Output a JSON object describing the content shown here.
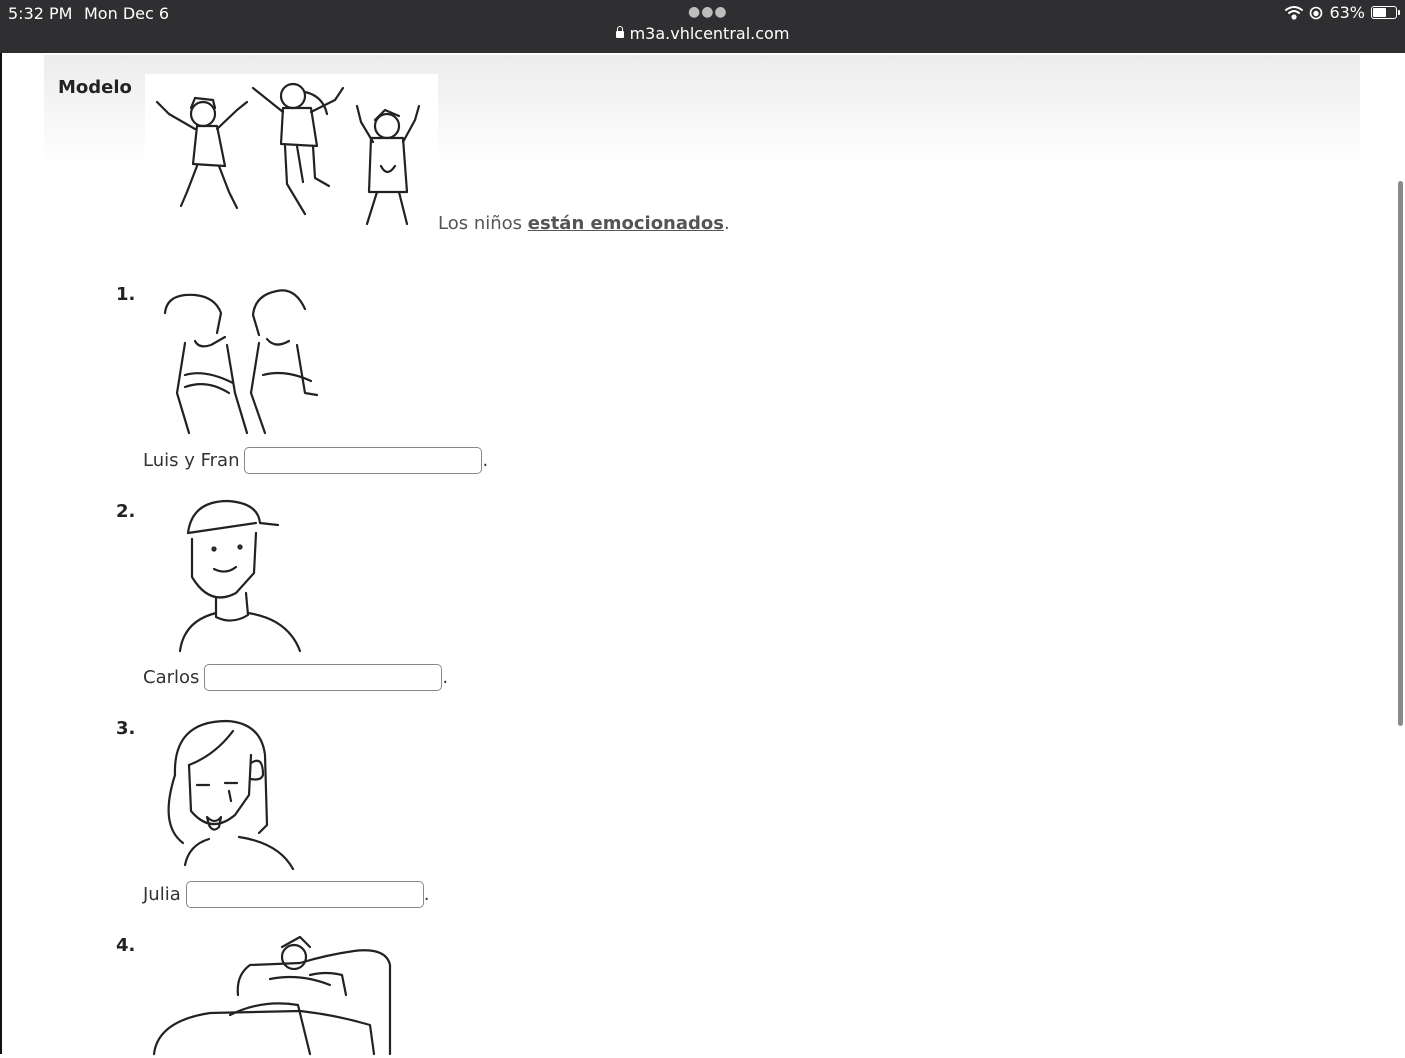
{
  "status_bar": {
    "time": "5:32 PM",
    "date": "Mon Dec 6",
    "url": "m3a.vhlcentral.com",
    "battery": "63%",
    "battery_level": 0.63
  },
  "exercise": {
    "model_label": "Modelo",
    "model_sentence_start": "Los niños ",
    "model_answer": "están emocionados",
    "model_period": ".",
    "items": [
      {
        "number": "1.",
        "subject": "Luis y Fran",
        "value": "",
        "period": "."
      },
      {
        "number": "2.",
        "subject": "Carlos",
        "value": "",
        "period": "."
      },
      {
        "number": "3.",
        "subject": "Julia",
        "value": "",
        "period": "."
      },
      {
        "number": "4."
      }
    ]
  }
}
